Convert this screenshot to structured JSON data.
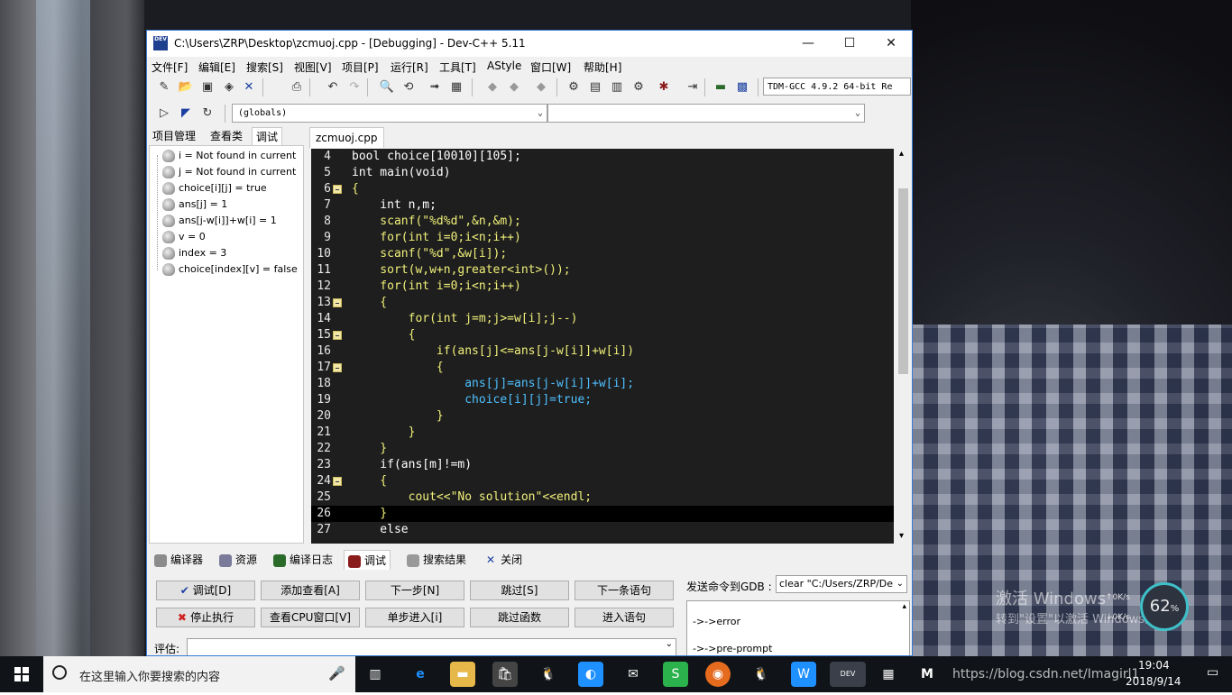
{
  "window": {
    "title": "C:\\Users\\ZRP\\Desktop\\zcmuoj.cpp - [Debugging] - Dev-C++ 5.11",
    "icon_text": "DEV",
    "min": "—",
    "max": "☐",
    "close": "✕"
  },
  "menu": [
    "文件[F]",
    "编辑[E]",
    "搜索[S]",
    "视图[V]",
    "项目[P]",
    "运行[R]",
    "工具[T]",
    "AStyle",
    "窗口[W]",
    "帮助[H]"
  ],
  "toolbar": {
    "compiler": "TDM-GCC 4.9.2 64-bit Re",
    "globals": "(globals)"
  },
  "left_tabs": [
    "项目管理",
    "查看类",
    "调试"
  ],
  "watches": [
    "i = Not found in current",
    "j = Not found in current",
    "choice[i][j] = true",
    "ans[j] = 1",
    "ans[j-w[i]]+w[i] = 1",
    "v = 0",
    "index = 3",
    "choice[index][v] = false"
  ],
  "editor": {
    "tab": "zcmuoj.cpp",
    "lines": [
      {
        "n": "4",
        "code": "bool choice[10010][105];"
      },
      {
        "n": "5",
        "code": "int main(void)"
      },
      {
        "n": "6",
        "code": "{"
      },
      {
        "n": "7",
        "code": "    int n,m;"
      },
      {
        "n": "8",
        "code": "    scanf(\"%d%d\",&n,&m);"
      },
      {
        "n": "9",
        "code": "    for(int i=0;i<n;i++)"
      },
      {
        "n": "10",
        "code": "    scanf(\"%d\",&w[i]);"
      },
      {
        "n": "11",
        "code": "    sort(w,w+n,greater<int>());"
      },
      {
        "n": "12",
        "code": "    for(int i=0;i<n;i++)"
      },
      {
        "n": "13",
        "code": "    {"
      },
      {
        "n": "14",
        "code": "        for(int j=m;j>=w[i];j--)"
      },
      {
        "n": "15",
        "code": "        {"
      },
      {
        "n": "16",
        "code": "            if(ans[j]<=ans[j-w[i]]+w[i])"
      },
      {
        "n": "17",
        "code": "            {"
      },
      {
        "n": "18",
        "code": "                ans[j]=ans[j-w[i]]+w[i];"
      },
      {
        "n": "19",
        "code": "                choice[i][j]=true;"
      },
      {
        "n": "20",
        "code": "            }"
      },
      {
        "n": "21",
        "code": "        }"
      },
      {
        "n": "22",
        "code": "    }"
      },
      {
        "n": "23",
        "code": "    if(ans[m]!=m)"
      },
      {
        "n": "24",
        "code": "    {"
      },
      {
        "n": "25",
        "code": "        cout<<\"No solution\"<<endl;"
      },
      {
        "n": "26",
        "code": "    }"
      },
      {
        "n": "27",
        "code": "    else"
      }
    ]
  },
  "bottom_tabs": [
    "编译器",
    "资源",
    "编译日志",
    "调试",
    "搜索结果",
    "关闭"
  ],
  "debug_buttons": {
    "row1": [
      "调试[D]",
      "添加查看[A]",
      "下一步[N]",
      "跳过[S]",
      "下一条语句"
    ],
    "row2": [
      "停止执行",
      "查看CPU窗口[V]",
      "单步进入[i]",
      "跳过函数",
      "进入语句"
    ]
  },
  "gdb": {
    "label": "发送命令到GDB :",
    "command": "clear \"C:/Users/ZRP/De",
    "output": [
      "->->error",
      "->->pre-prompt"
    ]
  },
  "evaluate_label": "评估:",
  "watermark": {
    "line1": "激活 Windows",
    "line2": "转到\"设置\"以激活 Windows。"
  },
  "net_widget": {
    "percent": "62",
    "unit": "%",
    "up": "0K/s",
    "down": "0K/s"
  },
  "taskbar": {
    "search_placeholder": "在这里输入你要搜索的内容",
    "clock_time": "19:04",
    "clock_date": "2018/9/14",
    "overlay_url": "https://blog.csdn.net/Imagirl1"
  }
}
